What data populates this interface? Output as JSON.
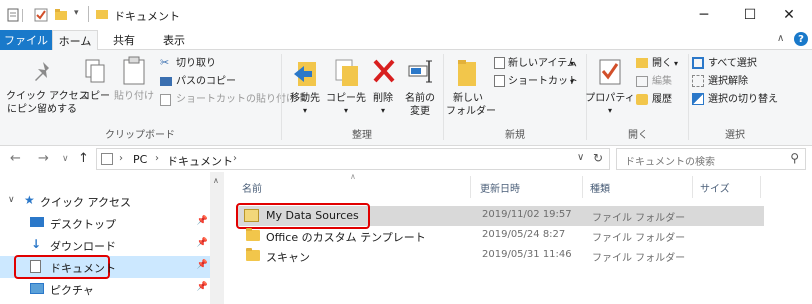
{
  "window": {
    "title": "ドキュメント"
  },
  "tabs": {
    "file": "ファイル",
    "home": "ホーム",
    "share": "共有",
    "view": "表示"
  },
  "ribbon": {
    "clipboard": {
      "label": "クリップボード",
      "pin_quick_access": [
        "クイック アクセス",
        "にピン留めする"
      ],
      "copy": "コピー",
      "paste": "貼り付け",
      "cut": "切り取り",
      "copy_path": "パスのコピー",
      "paste_shortcut": "ショートカットの貼り付け"
    },
    "organize": {
      "label": "整理",
      "move_to": "移動先",
      "copy_to": "コピー先",
      "delete": "削除",
      "rename": [
        "名前の",
        "変更"
      ]
    },
    "new": {
      "label": "新規",
      "new_folder": [
        "新しい",
        "フォルダー"
      ],
      "new_item": "新しいアイテム",
      "shortcut": "ショートカット"
    },
    "open": {
      "label": "開く",
      "properties": "プロパティ",
      "open": "開く",
      "edit": "編集",
      "history": "履歴"
    },
    "select": {
      "label": "選択",
      "select_all": "すべて選択",
      "select_none": "選択解除",
      "invert": "選択の切り替え"
    }
  },
  "address": {
    "crumbs": [
      "PC",
      "ドキュメント"
    ],
    "search_placeholder": "ドキュメントの検索"
  },
  "navpane": {
    "quick_access": "クイック アクセス",
    "items": [
      {
        "label": "デスクトップ",
        "pinned": true
      },
      {
        "label": "ダウンロード",
        "pinned": true
      },
      {
        "label": "ドキュメント",
        "pinned": true,
        "selected": true
      },
      {
        "label": "ピクチャ",
        "pinned": true
      }
    ]
  },
  "filelist": {
    "columns": [
      "名前",
      "更新日時",
      "種類",
      "サイズ"
    ],
    "rows": [
      {
        "name": "My Data Sources",
        "date": "2019/11/02 19:57",
        "type": "ファイル フォルダー",
        "selected": true
      },
      {
        "name": "Office のカスタム テンプレート",
        "date": "2019/05/24 8:27",
        "type": "ファイル フォルダー"
      },
      {
        "name": "スキャン",
        "date": "2019/05/31 11:46",
        "type": "ファイル フォルダー"
      }
    ]
  },
  "colors": {
    "accent": "#1979ca",
    "highlight": "#e10000",
    "selected_row": "#cce8ff"
  }
}
